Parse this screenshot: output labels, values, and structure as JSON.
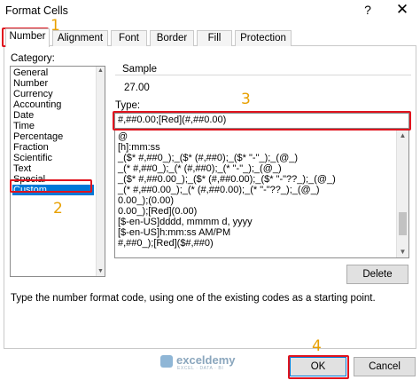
{
  "window": {
    "title": "Format Cells",
    "help_glyph": "?",
    "close_glyph": "✕"
  },
  "tabs": [
    {
      "label": "Number",
      "active": true
    },
    {
      "label": "Alignment",
      "active": false
    },
    {
      "label": "Font",
      "active": false
    },
    {
      "label": "Border",
      "active": false
    },
    {
      "label": "Fill",
      "active": false
    },
    {
      "label": "Protection",
      "active": false
    }
  ],
  "category": {
    "label": "Category:",
    "items": [
      "General",
      "Number",
      "Currency",
      "Accounting",
      "Date",
      "Time",
      "Percentage",
      "Fraction",
      "Scientific",
      "Text",
      "Special",
      "Custom"
    ],
    "selected": "Custom"
  },
  "sample": {
    "label": "Sample",
    "value": "27.00"
  },
  "type": {
    "label": "Type:",
    "value": "#,##0.00;[Red](#,##0.00)"
  },
  "formats": [
    "@",
    "[h]:mm:ss",
    "_($* #,##0_);_($* (#,##0);_($* \"-\"_);_(@_)",
    "_(* #,##0_);_(* (#,##0);_(* \"-\"_);_(@_)",
    "_($* #,##0.00_);_($* (#,##0.00);_($* \"-\"??_);_(@_)",
    "_(* #,##0.00_);_(* (#,##0.00);_(* \"-\"??_);_(@_)",
    "0.00_);(0.00)",
    "0.00_);[Red](0.00)",
    "[$-en-US]dddd, mmmm d, yyyy",
    "[$-en-US]h:mm:ss AM/PM",
    "#,##0_);[Red]($#,##0)"
  ],
  "buttons": {
    "delete": "Delete",
    "ok": "OK",
    "cancel": "Cancel"
  },
  "hint": "Type the number format code, using one of the existing codes as a starting point.",
  "annotations": [
    "1",
    "2",
    "3",
    "4"
  ],
  "annotation_color": "#e0141e",
  "watermark": {
    "name": "exceldemy",
    "tagline": "EXCEL · DATA · BI"
  }
}
